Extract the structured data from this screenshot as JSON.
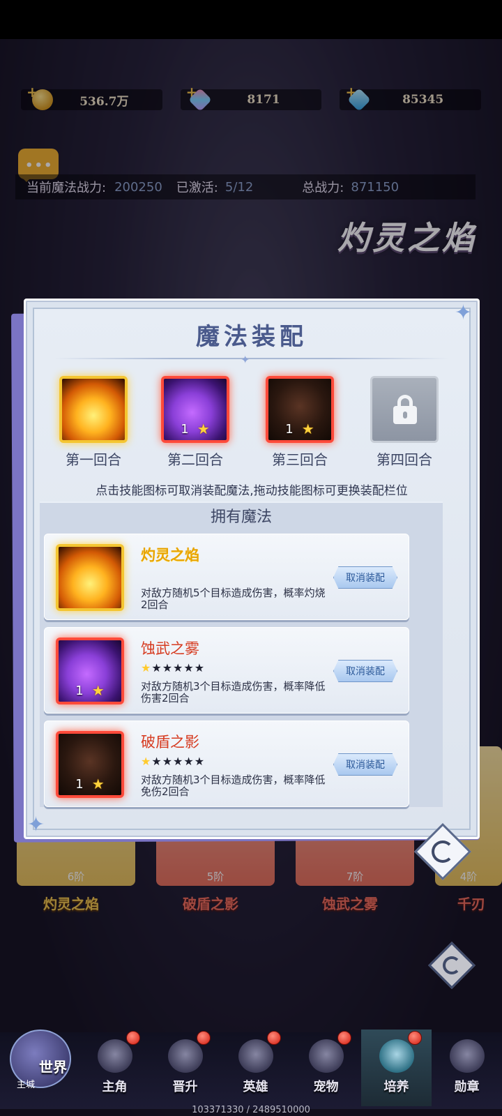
{
  "currency": [
    {
      "icon": "gold-coin-icon",
      "value": "536.7万"
    },
    {
      "icon": "rainbow-gem-icon",
      "value": "8171"
    },
    {
      "icon": "blue-diamond-icon",
      "value": "85345"
    }
  ],
  "stats": {
    "magic_power_label": "当前魔法战力:",
    "magic_power_value": "200250",
    "activated_label": "已激活:",
    "activated_value": "5/12",
    "total_power_label": "总战力:",
    "total_power_value": "871150"
  },
  "background_title": "灼灵之焰",
  "bg_cards": [
    {
      "tier": "6阶",
      "name": "灼灵之焰"
    },
    {
      "tier": "5阶",
      "name": "破盾之影"
    },
    {
      "tier": "7阶",
      "name": "蚀武之雾"
    },
    {
      "tier": "4阶",
      "name": "千刃"
    }
  ],
  "modal": {
    "title": "魔法装配",
    "slots": [
      {
        "label": "第一回合",
        "level": "",
        "stars": ""
      },
      {
        "label": "第二回合",
        "level": "1",
        "stars": "★"
      },
      {
        "label": "第三回合",
        "level": "1",
        "stars": "★"
      },
      {
        "label": "第四回合",
        "level": "",
        "stars": ""
      }
    ],
    "hint": "点击技能图标可取消装配魔法,拖动技能图标可更换装配栏位",
    "owned_title": "拥有魔法",
    "spells": [
      {
        "name": "灼灵之焰",
        "level": "",
        "star_icon": "",
        "desc": "对敌方随机5个目标造成伤害，概率灼烧2回合",
        "button": "取消装配"
      },
      {
        "name": "蚀武之雾",
        "level": "1",
        "star_icon": "★",
        "desc": "对敌方随机3个目标造成伤害，概率降低伤害2回合",
        "button": "取消装配"
      },
      {
        "name": "破盾之影",
        "level": "1",
        "star_icon": "★",
        "desc": "对敌方随机3个目标造成伤害，概率降低免伤2回合",
        "button": "取消装配"
      }
    ]
  },
  "nav": {
    "world_label": "世界",
    "world_sub": "主城",
    "items": [
      {
        "label": "主角"
      },
      {
        "label": "晋升"
      },
      {
        "label": "英雄"
      },
      {
        "label": "宠物"
      },
      {
        "label": "培养"
      },
      {
        "label": "勋章"
      }
    ]
  },
  "footer_text": "103371330 / 2489510000"
}
